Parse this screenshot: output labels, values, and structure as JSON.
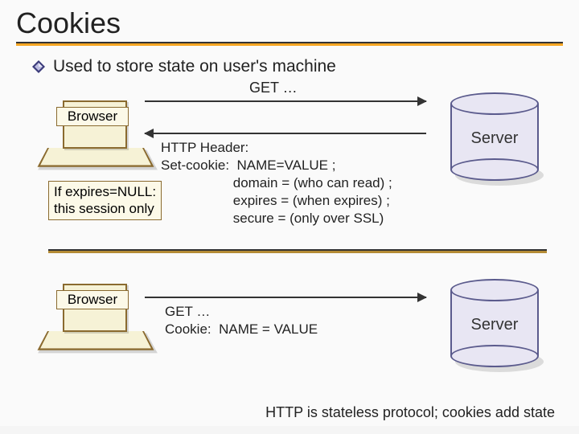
{
  "title": "Cookies",
  "bullet": "Used to store state on user's machine",
  "top": {
    "browser_label": "Browser",
    "server_label": "Server",
    "get_label": "GET …",
    "http_lines": "HTTP Header:\nSet-cookie:  NAME=VALUE ;\n                   domain = (who can read) ;\n                   expires = (when expires) ;\n                   secure = (only over SSL)",
    "callout": "If expires=NULL:\nthis session only"
  },
  "bottom": {
    "browser_label": "Browser",
    "server_label": "Server",
    "cookie_lines": "GET …\nCookie:  NAME = VALUE"
  },
  "footer": "HTTP is stateless protocol; cookies add state"
}
